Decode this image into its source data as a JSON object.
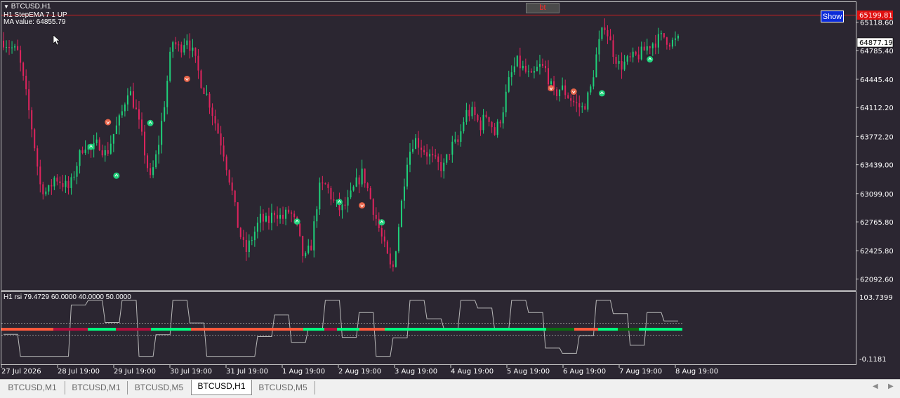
{
  "window": {
    "symbol_title": "BTCUSD,H1",
    "indicator_line": "H1 StepEMA 7 1 UP",
    "ma_value": "MA value: 64855.79",
    "show_button": "Show",
    "bt_button": "bt"
  },
  "price_axis": {
    "labels": [
      "65118.60",
      "64785.40",
      "64445.40",
      "64112.20",
      "63772.20",
      "63439.00",
      "63099.00",
      "62765.80",
      "62425.80",
      "62092.60"
    ],
    "red_line_price": "65199.81",
    "current_price": "64877.19"
  },
  "rsi_panel": {
    "title": "H1 rsi  79.4729 60.0000 40.0000 50.0000",
    "max_label": "103.7399",
    "min_label": "-0.1181"
  },
  "time_axis": {
    "labels": [
      "27 Jul 2026",
      "28 Jul 19:00",
      "29 Jul 19:00",
      "30 Jul 19:00",
      "31 Jul 19:00",
      "1 Aug 19:00",
      "2 Aug 19:00",
      "3 Aug 19:00",
      "4 Aug 19:00",
      "5 Aug 19:00",
      "6 Aug 19:00",
      "7 Aug 19:00",
      "8 Aug 19:00"
    ]
  },
  "tabs": [
    {
      "label": "BTCUSD,M1",
      "active": false
    },
    {
      "label": "BTCUSD,M1",
      "active": false
    },
    {
      "label": "BTCUSD,M5",
      "active": false
    },
    {
      "label": "BTCUSD,H1",
      "active": true
    },
    {
      "label": "BTCUSD,M5",
      "active": false
    }
  ],
  "colors": {
    "background": "#2b2631",
    "bull": "#1fd07a",
    "bear": "#e0245e",
    "rsi_up": "#00ff7f",
    "rsi_down": "#ff5a3c",
    "rsi_neutral_up": "#0b6b12",
    "rsi_neutral_down": "#b0103c"
  },
  "chart_data": {
    "type": "candlestick",
    "ylim": [
      61950,
      65280
    ],
    "price_levels": [
      65118.6,
      64785.4,
      64445.4,
      64112.2,
      63772.2,
      63439.0,
      63099.0,
      62765.8,
      62425.8,
      62092.6
    ],
    "close_path": [
      [
        0,
        64900
      ],
      [
        2,
        64750
      ],
      [
        3,
        64300
      ],
      [
        4,
        63800
      ],
      [
        5,
        63200
      ],
      [
        6,
        63100
      ],
      [
        7,
        63300
      ],
      [
        9,
        63150
      ],
      [
        10,
        63450
      ],
      [
        11,
        63700
      ],
      [
        12,
        63600
      ],
      [
        13,
        63700
      ],
      [
        14,
        63550
      ],
      [
        15,
        63800
      ],
      [
        16,
        64000
      ],
      [
        17,
        64350
      ],
      [
        18,
        64100
      ],
      [
        19,
        63700
      ],
      [
        20,
        63250
      ],
      [
        21,
        63600
      ],
      [
        22,
        64200
      ],
      [
        23,
        64900
      ],
      [
        24,
        64800
      ],
      [
        25,
        64950
      ],
      [
        26,
        64700
      ],
      [
        27,
        64400
      ],
      [
        28,
        64200
      ],
      [
        29,
        63900
      ],
      [
        30,
        63600
      ],
      [
        31,
        63200
      ],
      [
        32,
        62700
      ],
      [
        33,
        62400
      ],
      [
        34,
        62600
      ],
      [
        35,
        62800
      ],
      [
        36,
        62750
      ],
      [
        37,
        62900
      ],
      [
        38,
        62800
      ],
      [
        39,
        62900
      ],
      [
        40,
        62700
      ],
      [
        41,
        62300
      ],
      [
        42,
        62500
      ],
      [
        43,
        63150
      ],
      [
        44,
        63200
      ],
      [
        45,
        63000
      ],
      [
        46,
        62900
      ],
      [
        47,
        63000
      ],
      [
        48,
        63200
      ],
      [
        49,
        63350
      ],
      [
        50,
        63050
      ],
      [
        51,
        62750
      ],
      [
        52,
        62450
      ],
      [
        53,
        62150
      ],
      [
        54,
        62800
      ],
      [
        55,
        63500
      ],
      [
        56,
        63750
      ],
      [
        57,
        63650
      ],
      [
        58,
        63550
      ],
      [
        59,
        63450
      ],
      [
        60,
        63400
      ],
      [
        61,
        63650
      ],
      [
        62,
        63700
      ],
      [
        63,
        64050
      ],
      [
        64,
        64050
      ],
      [
        65,
        63900
      ],
      [
        66,
        64050
      ],
      [
        67,
        63800
      ],
      [
        68,
        64050
      ],
      [
        69,
        64450
      ],
      [
        70,
        64650
      ],
      [
        71,
        64550
      ],
      [
        72,
        64450
      ],
      [
        73,
        64600
      ],
      [
        74,
        64550
      ],
      [
        75,
        64250
      ],
      [
        76,
        64350
      ],
      [
        77,
        64250
      ],
      [
        78,
        64150
      ],
      [
        79,
        64100
      ],
      [
        80,
        64300
      ],
      [
        81,
        64800
      ],
      [
        82,
        65100
      ],
      [
        83,
        64800
      ],
      [
        84,
        64600
      ],
      [
        85,
        64650
      ],
      [
        86,
        64700
      ],
      [
        87,
        64750
      ],
      [
        88,
        64850
      ],
      [
        89,
        64900
      ],
      [
        90,
        64950
      ],
      [
        91,
        64880
      ],
      [
        92,
        64900
      ]
    ],
    "candle_count": 240,
    "rsi": {
      "ylim": [
        -0.1181,
        103.7399
      ],
      "levels": [
        60,
        40,
        50
      ],
      "last_value": 79.4729
    },
    "arrows_up": [
      [
        31,
        63650
      ],
      [
        40,
        63310
      ],
      [
        52,
        63930
      ],
      [
        104,
        62770
      ],
      [
        119,
        63000
      ],
      [
        134,
        62760
      ],
      [
        212,
        64280
      ],
      [
        229,
        64680
      ]
    ],
    "arrows_down": [
      [
        37,
        63940
      ],
      [
        65,
        64450
      ],
      [
        127,
        62960
      ],
      [
        194,
        64340
      ],
      [
        202,
        64300
      ]
    ]
  }
}
